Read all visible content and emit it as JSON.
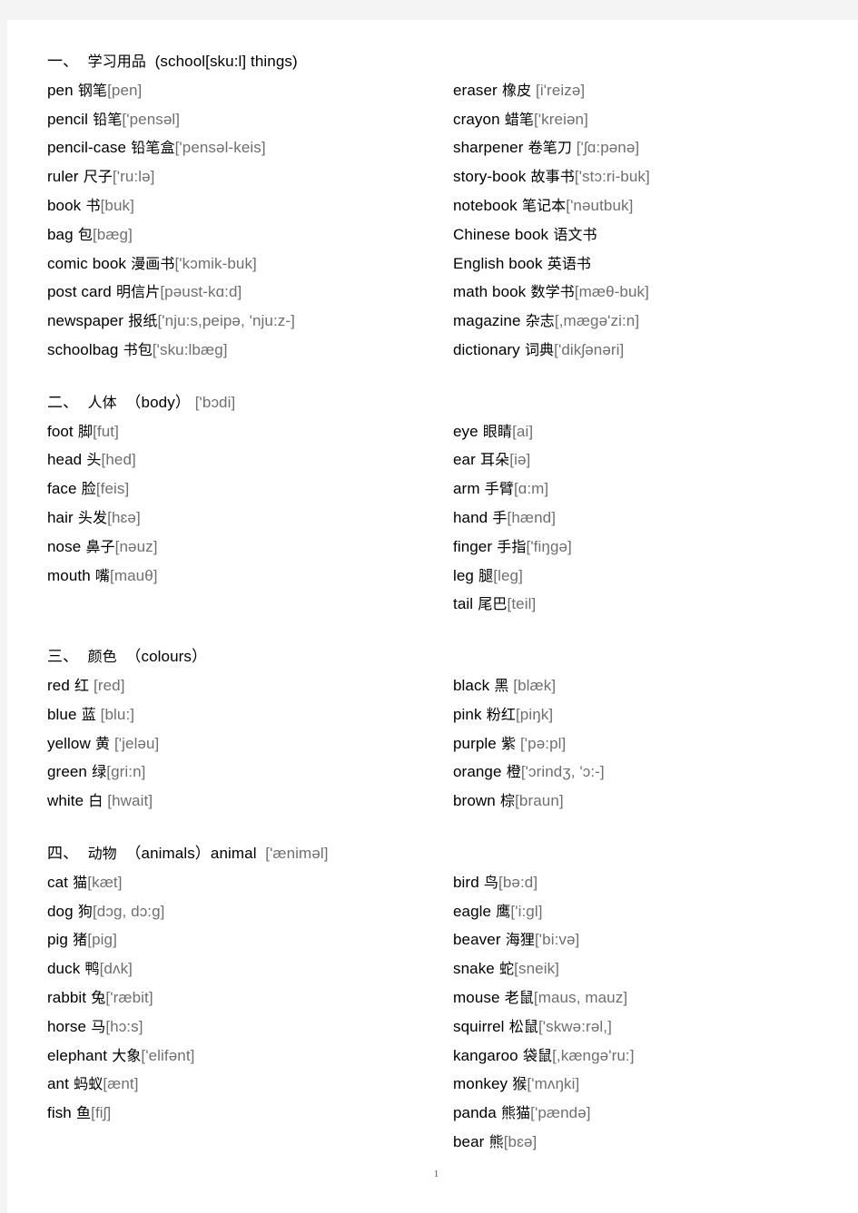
{
  "document": {
    "page_number": "1"
  },
  "sections": [
    {
      "id": "school-things",
      "heading": {
        "index": "一、",
        "cn": "学习用品",
        "en": "(school[sku:l] things)"
      },
      "left": [
        {
          "word": "pen",
          "cn": "钢笔",
          "ph": "[pen]"
        },
        {
          "word": "pencil",
          "cn": "铅笔",
          "ph": "['pensəl]"
        },
        {
          "word": "pencil-case",
          "cn": "铅笔盒",
          "ph": "['pensəl-keis]"
        },
        {
          "word": "ruler",
          "cn": "尺子",
          "ph": "['ru:lə]"
        },
        {
          "word": "book",
          "cn": "书",
          "ph": "[buk]"
        },
        {
          "word": "bag",
          "cn": "包",
          "ph": "[bæg]"
        },
        {
          "word": "comic book",
          "cn": "漫画书",
          "ph": "['kɔmik-buk]"
        },
        {
          "word": "post card",
          "cn": "明信片",
          "ph": "[pəust-kɑ:d]"
        },
        {
          "word": "newspaper",
          "cn": "报纸",
          "ph": "['nju:s,peipə, 'nju:z-]"
        },
        {
          "word": "schoolbag",
          "cn": "书包",
          "ph": "['sku:lbæg]"
        }
      ],
      "right": [
        {
          "word": "eraser",
          "cn": "橡皮",
          "ph": " [i'reizə]"
        },
        {
          "word": "crayon",
          "cn": "蜡笔",
          "ph": "['kreiən]"
        },
        {
          "word": "sharpener",
          "cn": "卷笔刀",
          "ph": " ['ʃɑ:pənə]"
        },
        {
          "word": "story-book",
          "cn": "故事书",
          "ph": "['stɔ:ri-buk]"
        },
        {
          "word": "notebook",
          "cn": "笔记本",
          "ph": "['nəutbuk]"
        },
        {
          "word": "Chinese book",
          "cn": "语文书",
          "ph": ""
        },
        {
          "word": "English book",
          "cn": "英语书",
          "ph": ""
        },
        {
          "word": "math book",
          "cn": "数学书",
          "ph": "[mæθ-buk]"
        },
        {
          "word": "magazine",
          "cn": "杂志",
          "ph": "[,mægə'zi:n]"
        },
        {
          "word": "dictionary",
          "cn": "词典",
          "ph": "['dikʃənəri]"
        }
      ]
    },
    {
      "id": "body",
      "heading": {
        "index": "二、",
        "cn": "人体",
        "en": "（body）",
        "ph": "['bɔdi]"
      },
      "left": [
        {
          "word": "foot",
          "cn": "脚",
          "ph": "[fut]"
        },
        {
          "word": "head",
          "cn": "头",
          "ph": "[hed]"
        },
        {
          "word": "face",
          "cn": "脸",
          "ph": "[feis]"
        },
        {
          "word": "hair",
          "cn": "头发",
          "ph": "[hɛə]"
        },
        {
          "word": "nose",
          "cn": "鼻子",
          "ph": "[nəuz]"
        },
        {
          "word": "mouth",
          "cn": "嘴",
          "ph": "[mauθ]"
        }
      ],
      "right": [
        {
          "word": "eye",
          "cn": "眼睛",
          "ph": "[ai]"
        },
        {
          "word": "ear",
          "cn": "耳朵",
          "ph": "[iə]"
        },
        {
          "word": "arm",
          "cn": "手臂",
          "ph": "[ɑ:m]"
        },
        {
          "word": "hand",
          "cn": "手",
          "ph": "[hænd]"
        },
        {
          "word": "finger",
          "cn": "手指",
          "ph": "['fiŋgə]"
        },
        {
          "word": "leg",
          "cn": "腿",
          "ph": "[leg]"
        },
        {
          "word": "tail",
          "cn": "尾巴",
          "ph": "[teil]"
        }
      ]
    },
    {
      "id": "colours",
      "heading": {
        "index": "三、",
        "cn": "颜色",
        "en": "（colours）"
      },
      "left": [
        {
          "word": "red",
          "cn": "红",
          "ph": " [red]"
        },
        {
          "word": "blue",
          "cn": "蓝",
          "ph": " [blu:]"
        },
        {
          "word": "yellow",
          "cn": "黄",
          "ph": " ['jeləu]"
        },
        {
          "word": "green",
          "cn": "绿",
          "ph": "[gri:n]"
        },
        {
          "word": "white",
          "cn": "白",
          "ph": " [hwait]"
        }
      ],
      "right": [
        {
          "word": "black",
          "cn": "黑",
          "ph": " [blæk]"
        },
        {
          "word": "pink",
          "cn": "粉红",
          "ph": "[piŋk]"
        },
        {
          "word": "purple",
          "cn": "紫",
          "ph": " ['pə:pl]"
        },
        {
          "word": "orange",
          "cn": "橙",
          "ph": "['ɔrindʒ, 'ɔ:-]"
        },
        {
          "word": "brown",
          "cn": "棕",
          "ph": "[braun]"
        }
      ]
    },
    {
      "id": "animals",
      "heading": {
        "index": "四、",
        "cn": "动物",
        "en": "（animals）animal",
        "ph": " ['æniməl]"
      },
      "left": [
        {
          "word": "cat",
          "cn": "猫",
          "ph": "[kæt]"
        },
        {
          "word": "dog",
          "cn": "狗",
          "ph": "[dɔg, dɔ:g]"
        },
        {
          "word": "pig",
          "cn": "猪",
          "ph": "[pig]"
        },
        {
          "word": "duck",
          "cn": "鸭",
          "ph": "[dʌk]"
        },
        {
          "word": "rabbit",
          "cn": "兔",
          "ph": "['ræbit]"
        },
        {
          "word": "horse",
          "cn": "马",
          "ph": "[hɔ:s]"
        },
        {
          "word": "elephant",
          "cn": "大象",
          "ph": "['elifənt]"
        },
        {
          "word": "ant",
          "cn": "蚂蚁",
          "ph": "[ænt]"
        },
        {
          "word": "fish",
          "cn": "鱼",
          "ph": "[fiʃ]"
        }
      ],
      "right": [
        {
          "word": "bird",
          "cn": "鸟",
          "ph": "[bə:d]"
        },
        {
          "word": "eagle",
          "cn": "鹰",
          "ph": "['i:gl]"
        },
        {
          "word": "beaver",
          "cn": "海狸",
          "ph": "['bi:və]"
        },
        {
          "word": "snake",
          "cn": "蛇",
          "ph": "[sneik]"
        },
        {
          "word": "mouse",
          "cn": "老鼠",
          "ph": "[maus, mauz]"
        },
        {
          "word": "squirrel",
          "cn": "松鼠",
          "ph": "['skwə:rəl,]"
        },
        {
          "word": "kangaroo",
          "cn": "袋鼠",
          "ph": "[,kængə'ru:]"
        },
        {
          "word": "monkey",
          "cn": "猴",
          "ph": "['mʌŋki]"
        },
        {
          "word": "panda",
          "cn": "熊猫",
          "ph": "['pændə]"
        },
        {
          "word": "bear",
          "cn": "熊",
          "ph": "[bɛə]"
        }
      ]
    }
  ]
}
